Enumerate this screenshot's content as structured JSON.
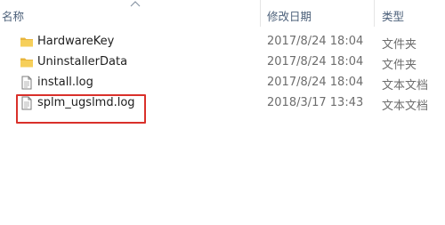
{
  "columns": {
    "name": "名称",
    "date": "修改日期",
    "type": "类型"
  },
  "icons": {
    "folder": "folder-icon",
    "file": "text-file-icon",
    "sort": "chevron-up-icon"
  },
  "colors": {
    "folder": "#f4c542",
    "highlight": "#d9302a"
  },
  "files": [
    {
      "name": "HardwareKey",
      "date": "2017/8/24 18:04",
      "type": "文件夹",
      "kind": "folder"
    },
    {
      "name": "UninstallerData",
      "date": "2017/8/24 18:04",
      "type": "文件夹",
      "kind": "folder"
    },
    {
      "name": "install.log",
      "date": "2017/8/24 18:04",
      "type": "文本文档",
      "kind": "file"
    },
    {
      "name": "splm_ugslmd.log",
      "date": "2018/3/17 13:43",
      "type": "文本文档",
      "kind": "file",
      "highlighted": true
    }
  ]
}
